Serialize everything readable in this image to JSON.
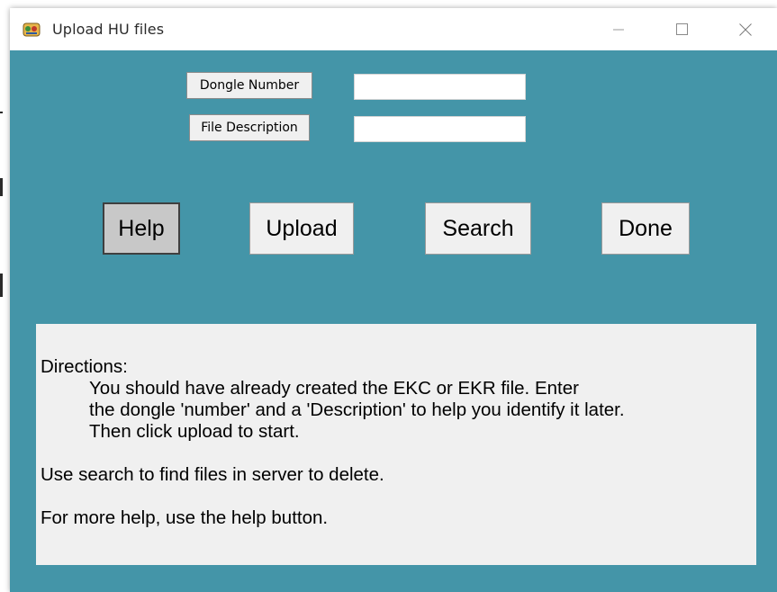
{
  "window": {
    "title": "Upload HU files",
    "app_icon": "hu-app-icon",
    "controls": {
      "minimize_icon": "minimize-icon",
      "maximize_icon": "maximize-icon",
      "close_icon": "close-icon"
    }
  },
  "colors": {
    "client_background": "#4495a8",
    "panel_background": "#f0f0f0",
    "help_button_background": "#c8c8c8"
  },
  "form": {
    "dongle_label": "Dongle Number",
    "dongle_value": "",
    "description_label": "File Description",
    "description_value": ""
  },
  "buttons": {
    "help": "Help",
    "upload": "Upload",
    "search": "Search",
    "done": "Done"
  },
  "directions": {
    "heading": "Directions:",
    "line1": "You should have already created the EKC or EKR file. Enter",
    "line2": "the dongle 'number' and a 'Description' to help you identify it later.",
    "line3": "Then click upload to start.",
    "search_note": "Use search to find files in server to delete.",
    "help_note": "For more help, use the help button."
  }
}
